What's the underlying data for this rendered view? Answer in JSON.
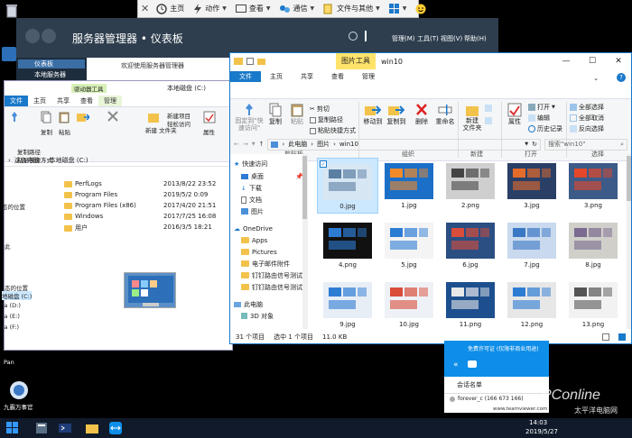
{
  "remote_toolbar": {
    "items": [
      {
        "label": "主页",
        "icon": "home-icon"
      },
      {
        "label": "动作",
        "icon": "action-icon"
      },
      {
        "label": "查看",
        "icon": "view-icon"
      },
      {
        "label": "通信",
        "icon": "communication-icon"
      },
      {
        "label": "文件与其他",
        "icon": "file-transfer-icon"
      }
    ]
  },
  "server_manager": {
    "title": "服务器管理器 • 仪表板",
    "menus": [
      "管理(M)",
      "工具(T)",
      "视图(V)",
      "帮助(H)"
    ],
    "welcome": "欢迎使用服务器管理器",
    "sidebar": [
      "仪表板",
      "本地服务器"
    ]
  },
  "explorer_c": {
    "title": "本地磁盘 (C:)",
    "tabs": [
      "文件",
      "主页",
      "共享",
      "查看"
    ],
    "context_tab_group": "驱动器工具",
    "context_tab": "管理",
    "ribbon": {
      "pin": "固定到\"快\n速访问\"",
      "copy": "复制",
      "paste": "粘贴",
      "cut": "剪切",
      "copy_path": "复制路径",
      "paste_shortcut": "粘贴快捷方式",
      "move_to": "移动到",
      "copy_to": "复制到",
      "delete": "删除",
      "rename": "重命名",
      "new_folder": "新建\n文件夹",
      "new_item": "新建项目",
      "easy_access": "轻松访问",
      "properties": "属性",
      "open": "打开"
    },
    "breadcrumb": [
      "这台电脑",
      "本地磁盘 (C:)"
    ],
    "files": [
      {
        "name": "PerfLogs",
        "date": "2013/8/22 23:52",
        "type": "文件夹"
      },
      {
        "name": "Program Files",
        "date": "2019/5/2 0:09",
        "type": "文件夹"
      },
      {
        "name": "Program Files (x86)",
        "date": "2017/4/20 21:51",
        "type": "文件夹"
      },
      {
        "name": "Windows",
        "date": "2017/7/25 16:08",
        "type": "文件夹"
      },
      {
        "name": "用户",
        "date": "2016/3/5 18:21",
        "type": "文件夹"
      }
    ],
    "left_labels": [
      "此",
      "面",
      "态的位置",
      "面",
      "档",
      "载",
      "乐",
      "片",
      "频",
      "地磁盘 (C:)",
      "ta (D:)",
      "ta (E:)",
      "ta (F:)",
      "Pan"
    ]
  },
  "explorer_w": {
    "title": "win10",
    "context_tab_group": "图片工具",
    "tabs": [
      "文件",
      "主页",
      "共享",
      "查看",
      "管理"
    ],
    "ribbon": {
      "pin": "固定到\"快\n速访问\"",
      "copy": "复制",
      "paste": "粘贴",
      "cut": "剪切",
      "copy_path": "复制路径",
      "paste_shortcut": "粘贴快捷方式",
      "move_to": "移动到",
      "copy_to": "复制到",
      "delete": "删除",
      "rename": "重命名",
      "new_folder": "新建\n文件夹",
      "properties": "属性",
      "open": "打开",
      "edit": "编辑",
      "history": "历史记录",
      "select_all": "全部选择",
      "select_none": "全部取消",
      "invert": "反向选择",
      "groups": [
        "剪贴板",
        "组织",
        "新建",
        "打开",
        "选择"
      ]
    },
    "breadcrumb": [
      "此电脑",
      "图片",
      "win10"
    ],
    "search_placeholder": "搜索\"win10\"",
    "nav": [
      {
        "label": "快速访问",
        "icon": "star-icon"
      },
      {
        "label": "桌面",
        "icon": "desktop-icon"
      },
      {
        "label": "下载",
        "icon": "download-icon"
      },
      {
        "label": "文档",
        "icon": "document-icon"
      },
      {
        "label": "图片",
        "icon": "picture-icon"
      },
      {
        "label": "OneDrive",
        "icon": "onedrive-icon"
      },
      {
        "label": "Apps",
        "icon": "folder-icon"
      },
      {
        "label": "Pictures",
        "icon": "folder-icon"
      },
      {
        "label": "电子邮件附件",
        "icon": "folder-icon"
      },
      {
        "label": "钉钉路由信号测试",
        "icon": "folder-icon"
      },
      {
        "label": "钉钉路由信号测试",
        "icon": "folder-icon"
      },
      {
        "label": "此电脑",
        "icon": "pc-icon"
      },
      {
        "label": "3D 对象",
        "icon": "3d-icon"
      }
    ],
    "files": [
      "0.jpg",
      "1.jpg",
      "2.png",
      "3.jpg",
      "3.png",
      "4.png",
      "5.jpg",
      "6.jpg",
      "7.jpg",
      "8.jpg",
      "9.jpg",
      "10.jpg",
      "11.png",
      "12.png",
      "13.png"
    ],
    "status_count": "31 个项目",
    "status_selected": "选中 1 个项目",
    "status_size": "11.0 KB"
  },
  "teamviewer": {
    "license_text": "免费许可证 (仅限非商业用途)",
    "session_title": "会话名单",
    "session_item": "forever_c (166 673 166)",
    "url": "www.teamviewer.com"
  },
  "taskbar": {
    "time": "14:03",
    "date": "2019/5/27",
    "app_label": "九霸万事官"
  },
  "watermark": {
    "brand": "PConline",
    "tagline": "太平洋电脑网"
  }
}
